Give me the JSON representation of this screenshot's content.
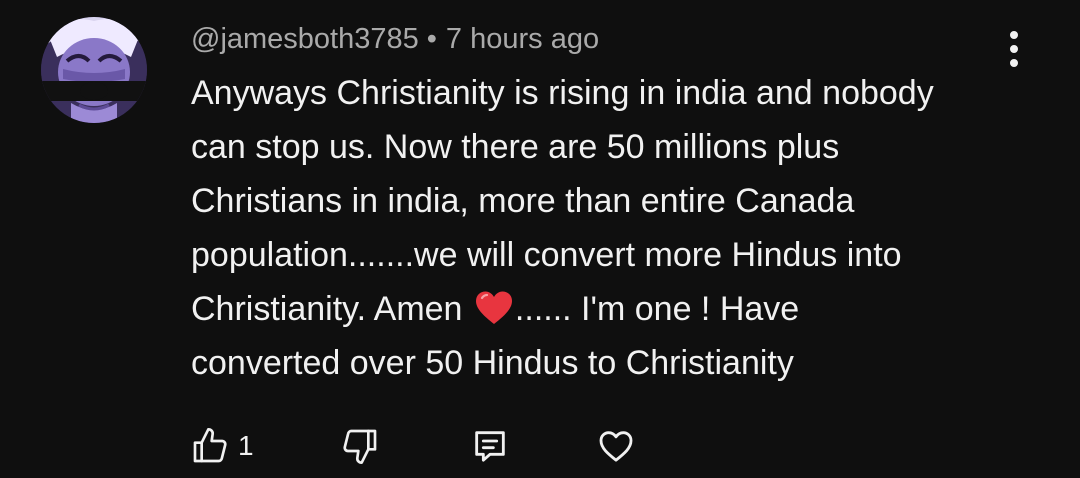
{
  "comment": {
    "author": "@jamesboth3785",
    "separator": "•",
    "timestamp": "7 hours ago",
    "text_lines": [
      "Anyways Christianity is rising in india and nobody",
      "can stop us. Now there are 50 millions plus",
      "Christians in india, more than entire Canada",
      "population.......we will convert more Hindus into"
    ],
    "text_line5_before_emoji": "Christianity. Amen ",
    "emoji": "red-heart",
    "text_line5_after_emoji": "...... I'm one ! Have",
    "text_line6": "converted over 50 Hindus to Christianity",
    "like_count": "1"
  },
  "icons": {
    "more": "more-vertical-icon",
    "like": "thumbs-up-icon",
    "dislike": "thumbs-down-icon",
    "reply": "reply-comment-icon",
    "heart": "heart-outline-icon"
  },
  "colors": {
    "background": "#0f0f0f",
    "text": "#f1f1f1",
    "meta": "#aaaaaa",
    "heart_emoji": "#e8353f"
  }
}
